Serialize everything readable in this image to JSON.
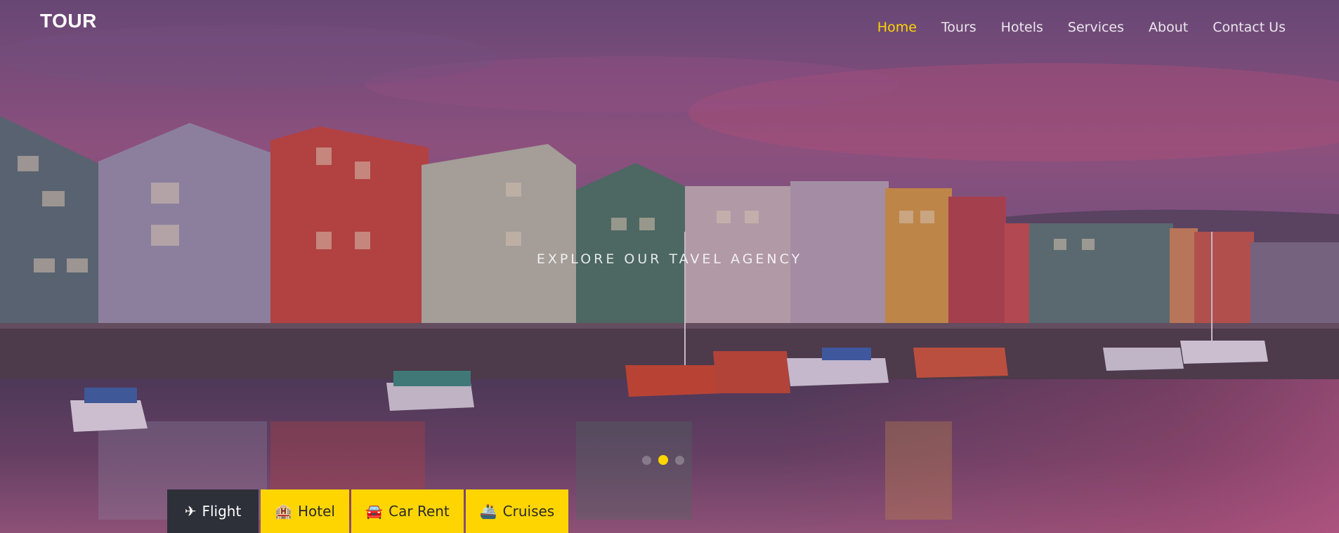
{
  "brand": {
    "name": "TOUR"
  },
  "nav": {
    "items": [
      {
        "label": "Home",
        "active": true
      },
      {
        "label": "Tours"
      },
      {
        "label": "Hotels"
      },
      {
        "label": "Services"
      },
      {
        "label": "About"
      },
      {
        "label": "Contact Us"
      }
    ]
  },
  "hero": {
    "tagline": "EXPLORE OUR TAVEL AGENCY",
    "slides": {
      "count": 3,
      "active_index": 1
    }
  },
  "booking_tabs": [
    {
      "label": "Flight",
      "icon": "airplane-icon",
      "glyph": "✈",
      "active": true
    },
    {
      "label": "Hotel",
      "icon": "hotel-icon",
      "glyph": "🏨"
    },
    {
      "label": "Car Rent",
      "icon": "car-icon",
      "glyph": "🚘"
    },
    {
      "label": "Cruises",
      "icon": "ship-icon",
      "glyph": "🚢"
    }
  ],
  "colors": {
    "accent": "#ffd500",
    "dark_tab": "#2d3038",
    "nav_text": "#ece6ee"
  }
}
